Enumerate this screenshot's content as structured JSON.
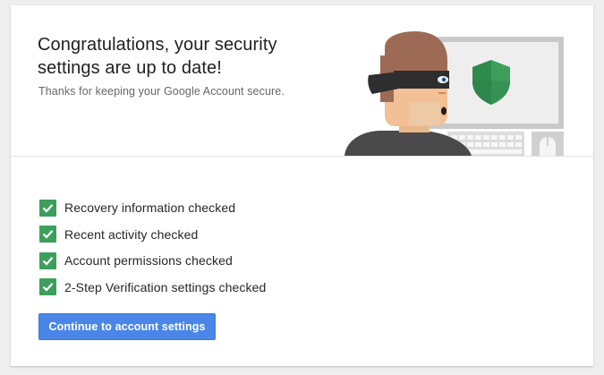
{
  "header": {
    "title": "Congratulations, your security settings are up to date!",
    "subtitle": "Thanks for keeping your Google Account secure."
  },
  "illustration": {
    "icons": [
      "person-icon",
      "computer-monitor-icon",
      "shield-icon",
      "keyboard-icon",
      "mouse-icon"
    ],
    "shield_color": "#3d9f5c"
  },
  "checklist": {
    "items": [
      {
        "label": "Recovery information checked",
        "icon": "checkmark-icon"
      },
      {
        "label": "Recent activity checked",
        "icon": "checkmark-icon"
      },
      {
        "label": "Account permissions checked",
        "icon": "checkmark-icon"
      },
      {
        "label": "2-Step Verification settings checked",
        "icon": "checkmark-icon"
      }
    ],
    "check_color": "#3d9f5c"
  },
  "actions": {
    "continue_label": "Continue to account settings",
    "button_color": "#4a86e8"
  }
}
